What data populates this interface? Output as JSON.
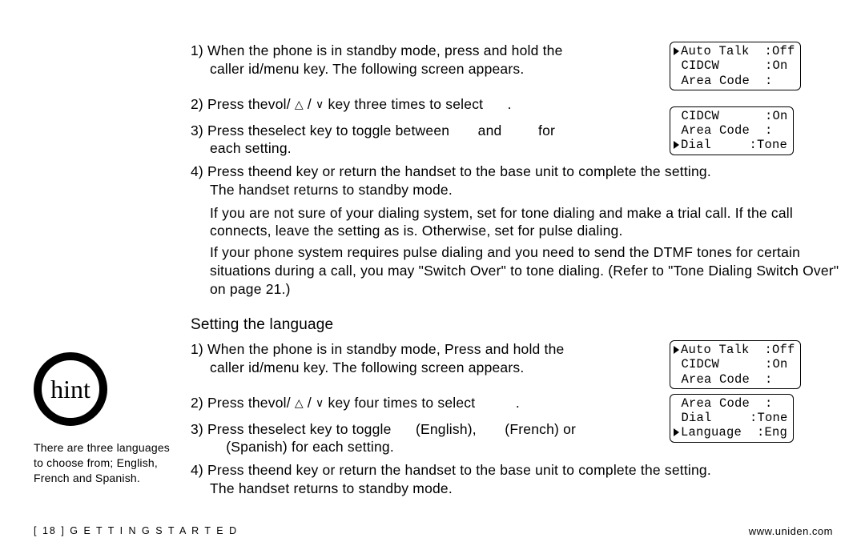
{
  "hint": {
    "label": "hint",
    "note": "There are three languages to choose from; English, French and Spanish."
  },
  "section1": {
    "step1_a": "1) When the phone is in standby mode, press and hold the",
    "step1_b": "caller id/menu key. The following screen appears.",
    "step2_a": "2) Press the",
    "step2_b": "vol/",
    "step2_c": " key three times to select ",
    "step2_d": ".",
    "step3_a": "3) Press the",
    "step3_b": "select",
    "step3_c": " key to toggle between ",
    "step3_d": " and ",
    "step3_e": " for",
    "step3_f": "each setting.",
    "step4_a": "4) Press the",
    "step4_b": "end",
    "step4_c": " key or return the handset to the base unit to complete the setting.",
    "step4_d": "The handset returns to standby mode.",
    "note1": "If you are not sure of your dialing system, set for tone dialing and make a trial call. If the call connects, leave the setting as is. Otherwise, set for pulse dialing.",
    "note2": "If your phone system requires pulse dialing and you need to send the DTMF tones for certain situations during a call, you may \"Switch Over\" to tone dialing. (Refer to \"Tone Dialing Switch Over\" on page 21.)"
  },
  "screens": {
    "s1_l1": "Auto Talk  :Off",
    "s1_l2": " CIDCW      :On",
    "s1_l3": " Area Code  :",
    "s2_l1": " CIDCW      :On",
    "s2_l2": " Area Code  :",
    "s2_l3": "Dial     :Tone",
    "s3_l1": "Auto Talk  :Off",
    "s3_l2": " CIDCW      :On",
    "s3_l3": " Area Code  :",
    "s4_l1": " Area Code  :",
    "s4_l2": " Dial     :Tone",
    "s4_l3": "Language  :Eng"
  },
  "section2": {
    "title": "Setting the language",
    "step1_a": "1) When the phone is in standby mode, Press and hold the",
    "step1_b": "caller id/menu key. The following screen appears.",
    "step2_a": "2) Press the",
    "step2_b": "vol/",
    "step2_c": " key four times to select ",
    "step2_d": ".",
    "step3_a": "3) Press the",
    "step3_b": "select",
    "step3_c": " key to toggle ",
    "step3_d": " (English), ",
    "step3_e": " (French) or",
    "step3_f": "(Spanish) for each setting.",
    "step4_a": "4) Press the",
    "step4_b": "end",
    "step4_c": " key or return the handset to the base unit to complete the setting.",
    "step4_d": "The handset returns to standby mode."
  },
  "footer": {
    "left": "[ 18 ]   G E T T I N G   S T A R T E D",
    "right": "www.uniden.com"
  }
}
